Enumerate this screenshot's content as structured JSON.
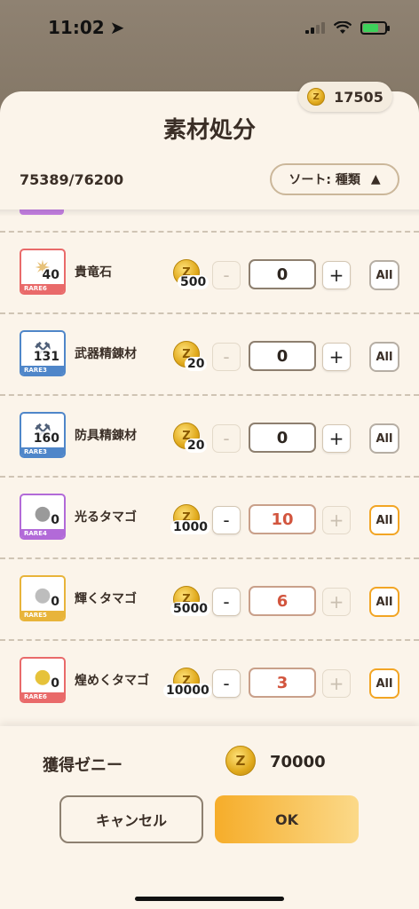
{
  "status_bar": {
    "time": "11:02"
  },
  "wallet": {
    "zenny": "17505"
  },
  "header": {
    "title": "素材処分",
    "capacity": "75389/76200",
    "sort_label": "ソート:  種類",
    "sort_arrow": "▲"
  },
  "items": [
    {
      "name": "貴竜石",
      "count": "40",
      "rarity": "RARE6",
      "rarity_color": "#e96a6a",
      "price": "500",
      "quantity": "0",
      "all_label": "All"
    },
    {
      "name": "武器精錬材",
      "count": "131",
      "rarity": "RARE3",
      "rarity_color": "#4f86c9",
      "price": "20",
      "quantity": "0",
      "all_label": "All"
    },
    {
      "name": "防具精錬材",
      "count": "160",
      "rarity": "RARE3",
      "rarity_color": "#4f86c9",
      "price": "20",
      "quantity": "0",
      "all_label": "All"
    },
    {
      "name": "光るタマゴ",
      "count": "0",
      "rarity": "RARE4",
      "rarity_color": "#b26ad8",
      "price": "1000",
      "quantity": "10",
      "all_label": "All"
    },
    {
      "name": "輝くタマゴ",
      "count": "0",
      "rarity": "RARE5",
      "rarity_color": "#e8b43a",
      "price": "5000",
      "quantity": "6",
      "all_label": "All"
    },
    {
      "name": "煌めくタマゴ",
      "count": "0",
      "rarity": "RARE6",
      "rarity_color": "#e96a6a",
      "price": "10000",
      "quantity": "3",
      "all_label": "All"
    }
  ],
  "stepper": {
    "minus": "-",
    "plus": "+"
  },
  "footer": {
    "earn_label": "獲得ゼニー",
    "earn_value": "70000",
    "cancel_label": "キャンセル",
    "ok_label": "OK"
  },
  "icons": {
    "gem": "sparkle-gem-icon",
    "weapon_mat": "anvil-icon",
    "armor_mat": "anvil-icon",
    "egg": "egg-icon",
    "coin": "zenny-coin-icon"
  }
}
